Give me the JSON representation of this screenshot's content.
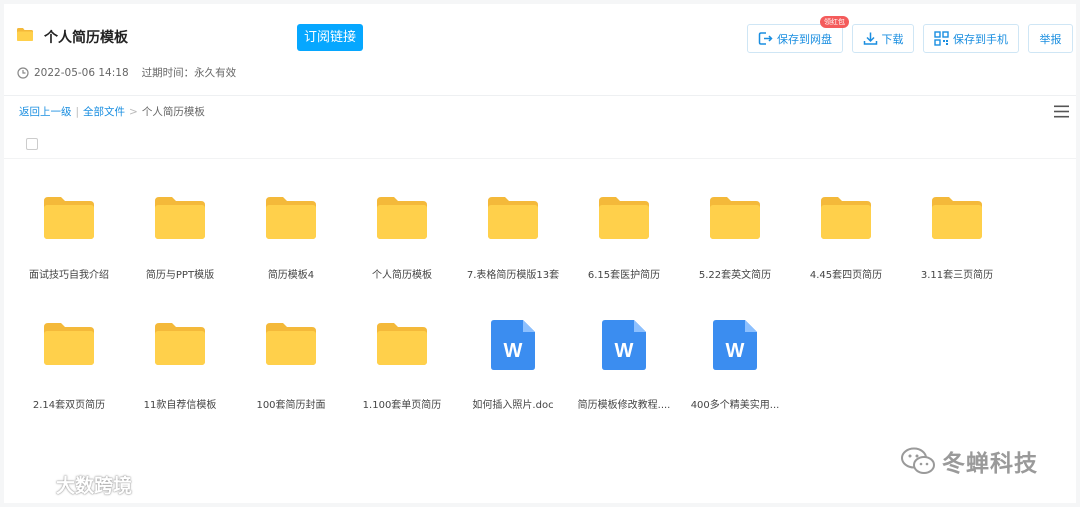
{
  "header": {
    "title": "个人简历模板",
    "subscribe_label": "订阅链接",
    "datetime": "2022-05-06 14:18",
    "expiry_label": "过期时间：永久有效",
    "badge": "领红包",
    "actions": {
      "save_netdisk": "保存到网盘",
      "download": "下载",
      "save_phone": "保存到手机",
      "report": "举报"
    }
  },
  "breadcrumb": {
    "back": "返回上一级",
    "all_files": "全部文件",
    "separator1": "|",
    "separator2": ">",
    "current": "个人简历模板"
  },
  "files": [
    {
      "name": "面试技巧自我介绍",
      "type": "folder"
    },
    {
      "name": "简历与PPT模版",
      "type": "folder"
    },
    {
      "name": "简历模板4",
      "type": "folder"
    },
    {
      "name": "个人简历模板",
      "type": "folder"
    },
    {
      "name": "7.表格简历模版13套",
      "type": "folder"
    },
    {
      "name": "6.15套医护简历",
      "type": "folder"
    },
    {
      "name": "5.22套英文简历",
      "type": "folder"
    },
    {
      "name": "4.45套四页简历",
      "type": "folder"
    },
    {
      "name": "3.11套三页简历",
      "type": "folder"
    },
    {
      "name": "2.14套双页简历",
      "type": "folder"
    },
    {
      "name": "11款自荐信模板",
      "type": "folder"
    },
    {
      "name": "100套简历封面",
      "type": "folder"
    },
    {
      "name": "1.100套单页简历",
      "type": "folder"
    },
    {
      "name": "如何插入照片.doc",
      "type": "doc"
    },
    {
      "name": "简历模板修改教程....",
      "type": "doc"
    },
    {
      "name": "400多个精美实用...",
      "type": "doc"
    }
  ],
  "doc_letter": "W",
  "watermark": {
    "right": "冬蝉科技",
    "left": "大数跨境"
  },
  "colors": {
    "accent": "#06a7ff",
    "link": "#1a8ee0",
    "folder": "#ffd04b",
    "folder_tab": "#f4b93a",
    "doc": "#3b8df0",
    "badge": "#f45b5b"
  },
  "icons": [
    "folder-icon",
    "clock-icon",
    "netdisk-icon",
    "download-icon",
    "qrcode-icon",
    "menu-icon",
    "word-doc-icon",
    "wechat-icon"
  ]
}
